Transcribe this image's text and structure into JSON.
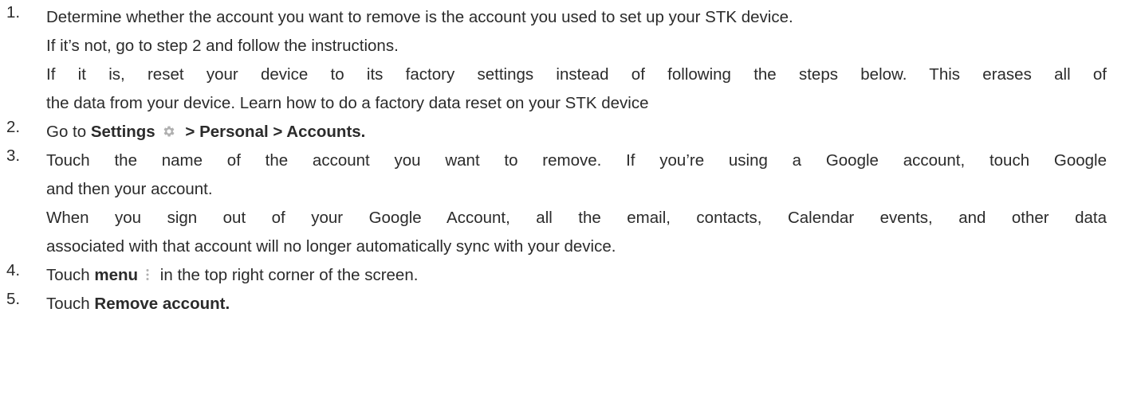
{
  "steps": [
    {
      "number": "1.",
      "lines": [
        "Determine whether the account you want to remove is the account you used to set up your STK device.",
        "If it’s not, go to step 2 and follow the instructions.",
        "If it is, reset your device to its factory settings instead of following the steps below. This erases all of",
        "the data from your device. Learn how to do a factory data reset on your STK device"
      ]
    },
    {
      "number": "2.",
      "prefix": "Go to ",
      "settings": "Settings",
      "path": " > Personal > Accounts.",
      "icon": "gear-icon"
    },
    {
      "number": "3.",
      "lines": [
        "Touch the name of the account you want to remove. If you’re using a Google account, touch Google",
        "and then your account.",
        "When you sign out of your Google Account, all the email, contacts, Calendar events, and other data",
        "associated with that account will no longer automatically sync with your device."
      ]
    },
    {
      "number": "4.",
      "prefix": "Touch ",
      "menu": "menu",
      "suffix": " in the top right corner of the screen.",
      "icon": "more-vertical-icon"
    },
    {
      "number": "5.",
      "prefix": "Touch ",
      "action": "Remove account."
    }
  ],
  "colors": {
    "text": "#2b2b2b",
    "icon": "#b0b0b0"
  }
}
